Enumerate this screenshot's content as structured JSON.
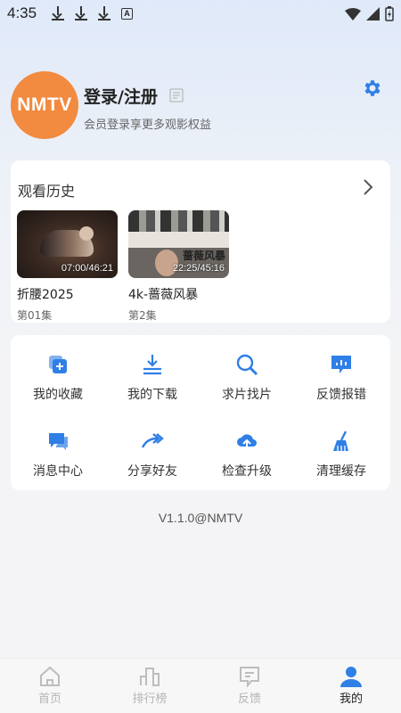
{
  "status_bar": {
    "time": "4:35",
    "notif_letter": "A"
  },
  "profile": {
    "avatar_text": "NMTV",
    "login_title": "登录/注册",
    "subtitle": "会员登录享更多观影权益"
  },
  "history": {
    "title": "观看历史",
    "items": [
      {
        "name": "折腰2025",
        "episode": "第01集",
        "time": "07:00/46:21"
      },
      {
        "name": "4k-蔷薇风暴",
        "episode": "第2集",
        "time": "22:25/45:16",
        "art_text": "蔷薇风暴"
      }
    ]
  },
  "tools": [
    {
      "label": "我的收藏",
      "icon": "favorites-icon"
    },
    {
      "label": "我的下载",
      "icon": "download-icon"
    },
    {
      "label": "求片找片",
      "icon": "search-icon"
    },
    {
      "label": "反馈报错",
      "icon": "feedback-icon"
    },
    {
      "label": "消息中心",
      "icon": "message-icon"
    },
    {
      "label": "分享好友",
      "icon": "share-icon"
    },
    {
      "label": "检查升级",
      "icon": "upgrade-icon"
    },
    {
      "label": "清理缓存",
      "icon": "broom-icon"
    }
  ],
  "version": "V1.1.0@NMTV",
  "bottom_nav": [
    {
      "label": "首页",
      "icon": "home-icon",
      "active": false
    },
    {
      "label": "排行榜",
      "icon": "ranking-icon",
      "active": false
    },
    {
      "label": "反馈",
      "icon": "feedback-nav-icon",
      "active": false
    },
    {
      "label": "我的",
      "icon": "profile-icon",
      "active": true
    }
  ],
  "colors": {
    "accent": "#2f7fe6",
    "avatar_bg": "#f28a3f",
    "inactive": "#b5b5b5"
  }
}
